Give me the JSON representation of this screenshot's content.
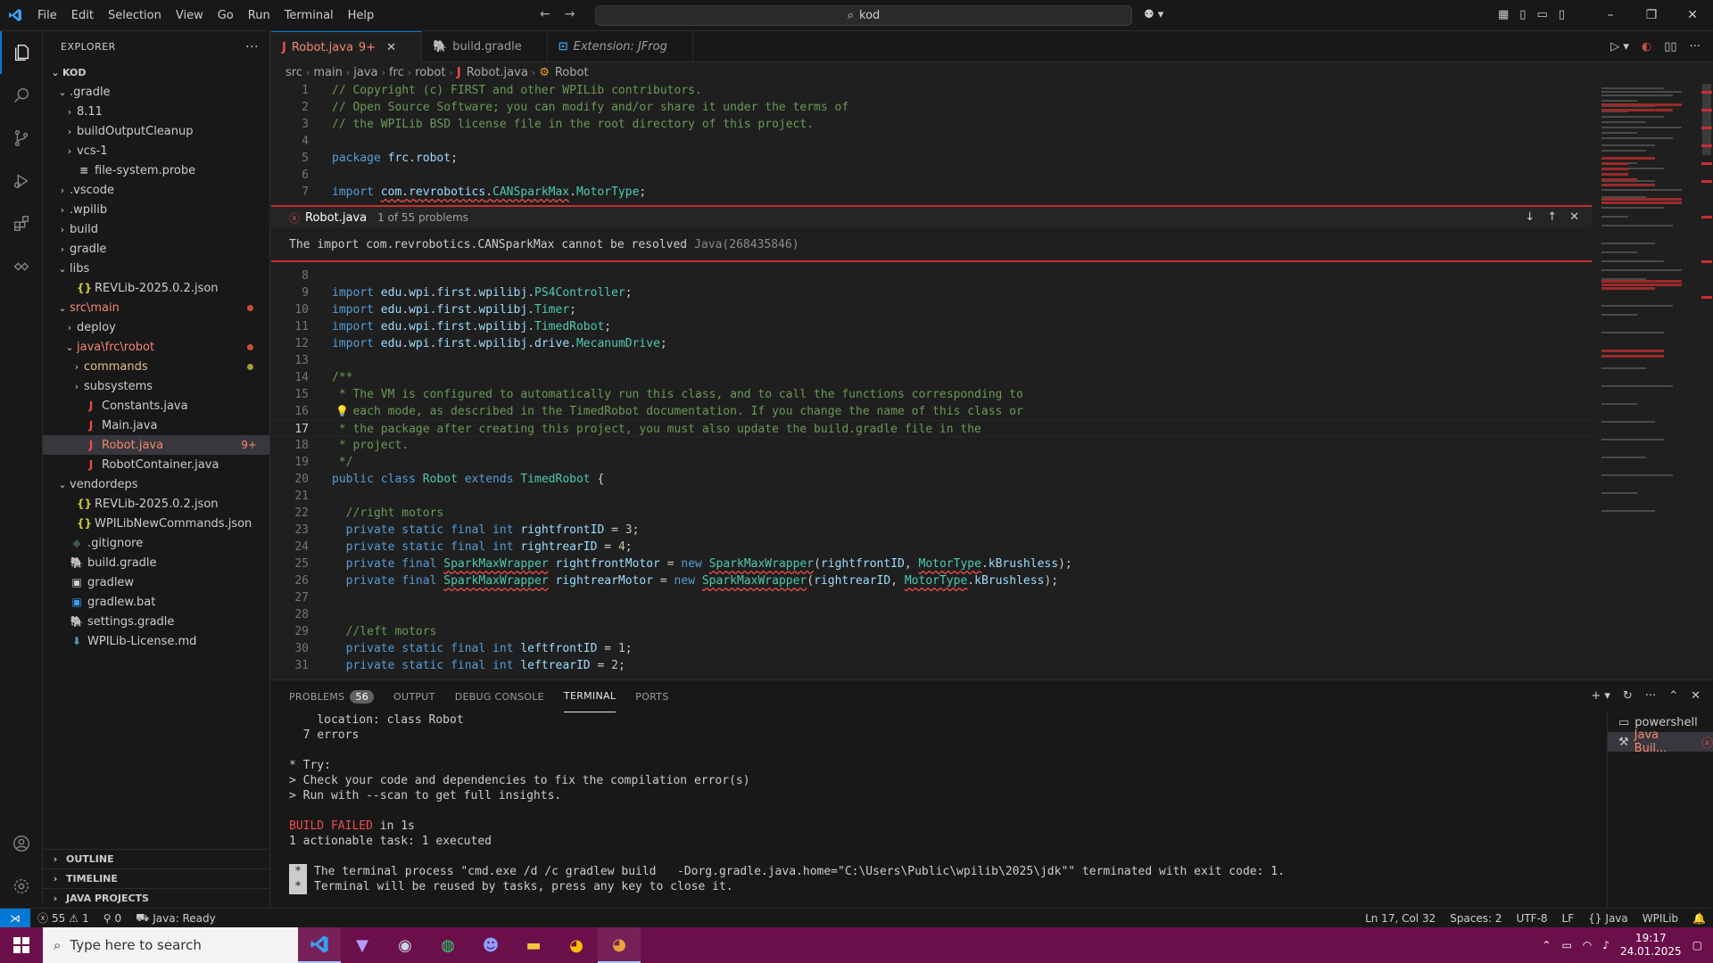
{
  "titlebar": {
    "menus": [
      "File",
      "Edit",
      "Selection",
      "View",
      "Go",
      "Run",
      "Terminal",
      "Help"
    ],
    "search_text": "kod"
  },
  "explorer": {
    "title": "EXPLORER",
    "root": "KOD",
    "items": [
      {
        "label": ".gradle",
        "indent": 1,
        "type": "folder-open",
        "color": "#cccccc"
      },
      {
        "label": "8.11",
        "indent": 2,
        "type": "folder",
        "color": "#cccccc"
      },
      {
        "label": "buildOutputCleanup",
        "indent": 2,
        "type": "folder",
        "color": "#cccccc"
      },
      {
        "label": "vcs-1",
        "indent": 2,
        "type": "folder",
        "color": "#cccccc"
      },
      {
        "label": "file-system.probe",
        "indent": 2,
        "type": "file",
        "icon": "≡",
        "iconColor": "#cccccc",
        "color": "#cccccc"
      },
      {
        "label": ".vscode",
        "indent": 1,
        "type": "folder",
        "color": "#cccccc"
      },
      {
        "label": ".wpilib",
        "indent": 1,
        "type": "folder",
        "color": "#cccccc"
      },
      {
        "label": "build",
        "indent": 1,
        "type": "folder",
        "color": "#cccccc"
      },
      {
        "label": "gradle",
        "indent": 1,
        "type": "folder",
        "color": "#cccccc"
      },
      {
        "label": "libs",
        "indent": 1,
        "type": "folder-open",
        "color": "#cccccc"
      },
      {
        "label": "REVLib-2025.0.2.json",
        "indent": 2,
        "type": "file",
        "icon": "{}",
        "iconColor": "#cbcb41",
        "color": "#cccccc"
      },
      {
        "label": "src\\main",
        "indent": 1,
        "type": "folder-open",
        "color": "#f48771",
        "dot": "#c74e39"
      },
      {
        "label": "deploy",
        "indent": 2,
        "type": "folder",
        "color": "#cccccc"
      },
      {
        "label": "java\\frc\\robot",
        "indent": 2,
        "type": "folder-open",
        "color": "#f48771",
        "dot": "#c74e39"
      },
      {
        "label": "commands",
        "indent": 3,
        "type": "folder",
        "color": "#e2c08d",
        "dot": "#a89a3c"
      },
      {
        "label": "subsystems",
        "indent": 3,
        "type": "folder",
        "color": "#cccccc"
      },
      {
        "label": "Constants.java",
        "indent": 3,
        "type": "file",
        "icon": "J",
        "iconColor": "#f14c4c",
        "color": "#cccccc"
      },
      {
        "label": "Main.java",
        "indent": 3,
        "type": "file",
        "icon": "J",
        "iconColor": "#f14c4c",
        "color": "#cccccc"
      },
      {
        "label": "Robot.java",
        "indent": 3,
        "type": "file",
        "icon": "J",
        "iconColor": "#f14c4c",
        "color": "#f48771",
        "selected": true,
        "badge": "9+"
      },
      {
        "label": "RobotContainer.java",
        "indent": 3,
        "type": "file",
        "icon": "J",
        "iconColor": "#f14c4c",
        "color": "#cccccc"
      },
      {
        "label": "vendordeps",
        "indent": 1,
        "type": "folder-open",
        "color": "#cccccc"
      },
      {
        "label": "REVLib-2025.0.2.json",
        "indent": 2,
        "type": "file",
        "icon": "{}",
        "iconColor": "#cbcb41",
        "color": "#cccccc"
      },
      {
        "label": "WPILibNewCommands.json",
        "indent": 2,
        "type": "file",
        "icon": "{}",
        "iconColor": "#cbcb41",
        "color": "#cccccc"
      },
      {
        "label": ".gitignore",
        "indent": 1,
        "type": "file",
        "icon": "◆",
        "iconColor": "#41535b",
        "color": "#cccccc"
      },
      {
        "label": "build.gradle",
        "indent": 1,
        "type": "file",
        "icon": "🐘",
        "iconColor": "#3aa0f0",
        "color": "#cccccc"
      },
      {
        "label": "gradlew",
        "indent": 1,
        "type": "file",
        "icon": "▣",
        "iconColor": "#cccccc",
        "color": "#cccccc"
      },
      {
        "label": "gradlew.bat",
        "indent": 1,
        "type": "file",
        "icon": "▣",
        "iconColor": "#3aa0f0",
        "color": "#cccccc"
      },
      {
        "label": "settings.gradle",
        "indent": 1,
        "type": "file",
        "icon": "🐘",
        "iconColor": "#3aa0f0",
        "color": "#cccccc"
      },
      {
        "label": "WPILib-License.md",
        "indent": 1,
        "type": "file",
        "icon": "⬇",
        "iconColor": "#519aba",
        "color": "#cccccc"
      }
    ],
    "sections": [
      "OUTLINE",
      "TIMELINE",
      "JAVA PROJECTS"
    ]
  },
  "tabs": [
    {
      "label": "Robot.java",
      "suffix": "9+",
      "icon": "J",
      "active": true
    },
    {
      "label": "build.gradle",
      "icon": "🐘",
      "active": false
    },
    {
      "label": "Extension: JFrog",
      "icon": "⊡",
      "active": false,
      "italic": true
    }
  ],
  "breadcrumb": [
    "src",
    "main",
    "java",
    "frc",
    "robot",
    "Robot.java",
    "Robot"
  ],
  "code_top": [
    {
      "n": "1",
      "html": "<span class='c-com'>// Copyright (c) FIRST and other WPILib contributors.</span>"
    },
    {
      "n": "2",
      "html": "<span class='c-com'>// Open Source Software; you can modify and/or share it under the terms of</span>"
    },
    {
      "n": "3",
      "html": "<span class='c-com'>// the WPILib BSD license file in the root directory of this project.</span>"
    },
    {
      "n": "4",
      "html": ""
    },
    {
      "n": "5",
      "html": "<span class='c-kw'>package</span> <span class='c-var'>frc</span>.<span class='c-var'>robot</span>;"
    },
    {
      "n": "6",
      "html": ""
    },
    {
      "n": "7",
      "html": "<span class='c-kw'>import</span> <span class='squig'><span class='c-var'>com</span>.<span class='c-var'>revrobotics</span>.<span class='c-ty'>CANSparkMax</span></span>.<span class='c-ty'>MotorType</span>;"
    }
  ],
  "peek": {
    "file": "Robot.java",
    "count": "1 of 55 problems",
    "message": "The import com.revrobotics.CANSparkMax cannot be resolved",
    "source": "Java(268435846)"
  },
  "code_bottom": [
    {
      "n": "8",
      "html": ""
    },
    {
      "n": "9",
      "html": "<span class='c-kw'>import</span> <span class='c-var'>edu</span>.<span class='c-var'>wpi</span>.<span class='c-var'>first</span>.<span class='c-var'>wpilibj</span>.<span class='c-ty'>PS4Controller</span>;"
    },
    {
      "n": "10",
      "html": "<span class='c-kw'>import</span> <span class='c-var'>edu</span>.<span class='c-var'>wpi</span>.<span class='c-var'>first</span>.<span class='c-var'>wpilibj</span>.<span class='c-ty'>Timer</span>;"
    },
    {
      "n": "11",
      "html": "<span class='c-kw'>import</span> <span class='c-var'>edu</span>.<span class='c-var'>wpi</span>.<span class='c-var'>first</span>.<span class='c-var'>wpilibj</span>.<span class='c-ty'>TimedRobot</span>;"
    },
    {
      "n": "12",
      "html": "<span class='c-kw'>import</span> <span class='c-var'>edu</span>.<span class='c-var'>wpi</span>.<span class='c-var'>first</span>.<span class='c-var'>wpilibj</span>.<span class='c-var'>drive</span>.<span class='c-ty'>MecanumDrive</span>;"
    },
    {
      "n": "13",
      "html": ""
    },
    {
      "n": "14",
      "html": "<span class='c-com'>/**</span>"
    },
    {
      "n": "15",
      "html": "<span class='c-com'> * The VM is configured to automatically run this class, and to call the functions corresponding to</span>"
    },
    {
      "n": "16",
      "html": "<span class='c-com'> * each mode, as described in the TimedRobot documentation. If you change the name of this class or</span>",
      "bulb": true
    },
    {
      "n": "17",
      "html": "<span class='c-com'> * the package after creating this project, you must also update the build.gradle file in the</span>",
      "current": true
    },
    {
      "n": "18",
      "html": "<span class='c-com'> * project.</span>"
    },
    {
      "n": "19",
      "html": "<span class='c-com'> */</span>"
    },
    {
      "n": "20",
      "html": "<span class='c-kw'>public</span> <span class='c-kw'>class</span> <span class='c-ty'>Robot</span> <span class='c-kw'>extends</span> <span class='c-ty'>TimedRobot</span> {"
    },
    {
      "n": "21",
      "html": ""
    },
    {
      "n": "22",
      "html": "  <span class='c-com'>//right motors</span>"
    },
    {
      "n": "23",
      "html": "  <span class='c-kw'>private</span> <span class='c-kw'>static</span> <span class='c-kw'>final</span> <span class='c-kw'>int</span> <span class='c-var'>rightfrontID</span> = <span class='c-num'>3</span>;"
    },
    {
      "n": "24",
      "html": "  <span class='c-kw'>private</span> <span class='c-kw'>static</span> <span class='c-kw'>final</span> <span class='c-kw'>int</span> <span class='c-var'>rightrearID</span> = <span class='c-num'>4</span>;"
    },
    {
      "n": "25",
      "html": "  <span class='c-kw'>private</span> <span class='c-kw'>final</span> <span class='c-ty squig'>SparkMaxWrapper</span> <span class='c-var'>rightfrontMotor</span> = <span class='c-kw'>new</span> <span class='c-ty squig'>SparkMaxWrapper</span>(<span class='c-var'>rightfrontID</span>, <span class='c-ty squig'>MotorType</span>.<span class='c-var'>kBrushless</span>);"
    },
    {
      "n": "26",
      "html": "  <span class='c-kw'>private</span> <span class='c-kw'>final</span> <span class='c-ty squig'>SparkMaxWrapper</span> <span class='c-var'>rightrearMotor</span> = <span class='c-kw'>new</span> <span class='c-ty squig'>SparkMaxWrapper</span>(<span class='c-var'>rightrearID</span>, <span class='c-ty squig'>MotorType</span>.<span class='c-var'>kBrushless</span>);"
    },
    {
      "n": "27",
      "html": ""
    },
    {
      "n": "28",
      "html": ""
    },
    {
      "n": "29",
      "html": "  <span class='c-com'>//left motors</span>"
    },
    {
      "n": "30",
      "html": "  <span class='c-kw'>private</span> <span class='c-kw'>static</span> <span class='c-kw'>final</span> <span class='c-kw'>int</span> <span class='c-var'>leftfrontID</span> = <span class='c-num'>1</span>;"
    },
    {
      "n": "31",
      "html": "  <span class='c-kw'>private</span> <span class='c-kw'>static</span> <span class='c-kw'>final</span> <span class='c-kw'>int</span> <span class='c-var'>leftrearID</span> = <span class='c-num'>2</span>;"
    }
  ],
  "panel": {
    "tabs": [
      {
        "label": "PROBLEMS",
        "badge": "56"
      },
      {
        "label": "OUTPUT"
      },
      {
        "label": "DEBUG CONSOLE"
      },
      {
        "label": "TERMINAL",
        "active": true
      },
      {
        "label": "PORTS"
      }
    ],
    "terminal_lines": [
      {
        "text": "    location: class Robot"
      },
      {
        "text": "  7 errors"
      },
      {
        "text": ""
      },
      {
        "text": "* Try:"
      },
      {
        "text": "> Check your code and dependencies to fix the compilation error(s)"
      },
      {
        "text": "> Run with --scan to get full insights."
      },
      {
        "text": ""
      },
      {
        "text": "BUILD FAILED",
        "rest": " in 1s",
        "red": true
      },
      {
        "text": "1 actionable task: 1 executed"
      },
      {
        "text": ""
      },
      {
        "text": "The terminal process \"cmd.exe /d /c gradlew build   -Dorg.gradle.java.home=\"C:\\Users\\Public\\wpilib\\2025\\jdk\"\" terminated with exit code: 1.",
        "star": true
      },
      {
        "text": "Terminal will be reused by tasks, press any key to close it.",
        "star": true
      }
    ],
    "terminals": [
      {
        "label": "powershell",
        "icon": "▭"
      },
      {
        "label": "Java Buil...",
        "icon": "✕",
        "selected": true
      }
    ]
  },
  "statusbar": {
    "errors": "55",
    "warnings": "1",
    "ports": "0",
    "java_status": "Java: Ready",
    "cursor": "Ln 17, Col 32",
    "spaces": "Spaces: 2",
    "encoding": "UTF-8",
    "eol": "LF",
    "language": "Java",
    "wpilib": "WPILib"
  },
  "taskbar": {
    "search_placeholder": "Type here to search",
    "time": "19:17",
    "date": "24.01.2025"
  },
  "colors": {
    "accent": "#0078d4",
    "error": "#f14c4c",
    "taskbar": "#6b0f4a"
  }
}
